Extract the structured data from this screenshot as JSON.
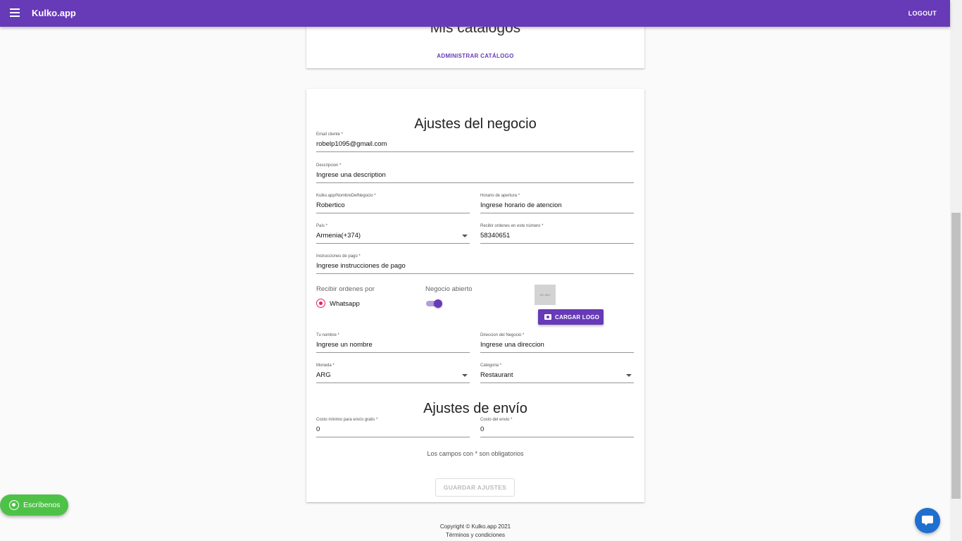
{
  "appbar": {
    "brand": "Kulko.app",
    "logout": "LOGOUT"
  },
  "catalogs_card": {
    "title": "Mis catálogos",
    "admin_link": "ADMINISTRAR CATÁLOGO"
  },
  "business": {
    "title": "Ajustes del negocio",
    "email": {
      "label": "Email cliente *",
      "value": "robelp1095@gmail.com"
    },
    "description": {
      "label": "Descripcion *",
      "value": "Ingrese una description"
    },
    "slug": {
      "label": "Kulko.app/NombreDelNegocio *",
      "value": "Robertico"
    },
    "hours": {
      "label": "Horario de apertura *",
      "value": "Ingrese horario de atencion"
    },
    "country": {
      "label": "País *",
      "value": "Armenia(+374)"
    },
    "phone": {
      "label": "Recibir ordenes en este número *",
      "value": "58340651"
    },
    "payment": {
      "label": "Instrucciones de pago *",
      "value": "Ingrese instrucciones de pago"
    },
    "receive_label": "Recibir ordenes por",
    "receive_option": "Whatsapp",
    "open_label": "Negocio abierto",
    "open": true,
    "logo_placeholder": "NO IMG",
    "upload_label": "CARGAR LOGO",
    "name": {
      "label": "Tu nombre *",
      "value": "Ingrese un nombre"
    },
    "address": {
      "label": "Direccion del Negocio *",
      "value": "Ingrese una direccion"
    },
    "currency": {
      "label": "Moneda *",
      "value": "ARG"
    },
    "category": {
      "label": "Categoria *",
      "value": "Restaurant"
    }
  },
  "shipping": {
    "title": "Ajustes de envío",
    "min_free": {
      "label": "Costo mínimo para envío gratis *",
      "value": "0"
    },
    "cost": {
      "label": "Costo del envio *",
      "value": "0"
    }
  },
  "required_note": "Los campos con * son obligatorios",
  "save_label": "GUARDAR AJUSTES",
  "footer": {
    "copyright": "Copyright © Kulko.app 2021",
    "terms": "Términos y condiciones"
  },
  "whatsapp_label": "Escríbenos",
  "colors": {
    "primary": "#673ab7",
    "radio": "#e91e63",
    "whatsapp": "#4dc247",
    "chat": "#1e6fd0"
  }
}
